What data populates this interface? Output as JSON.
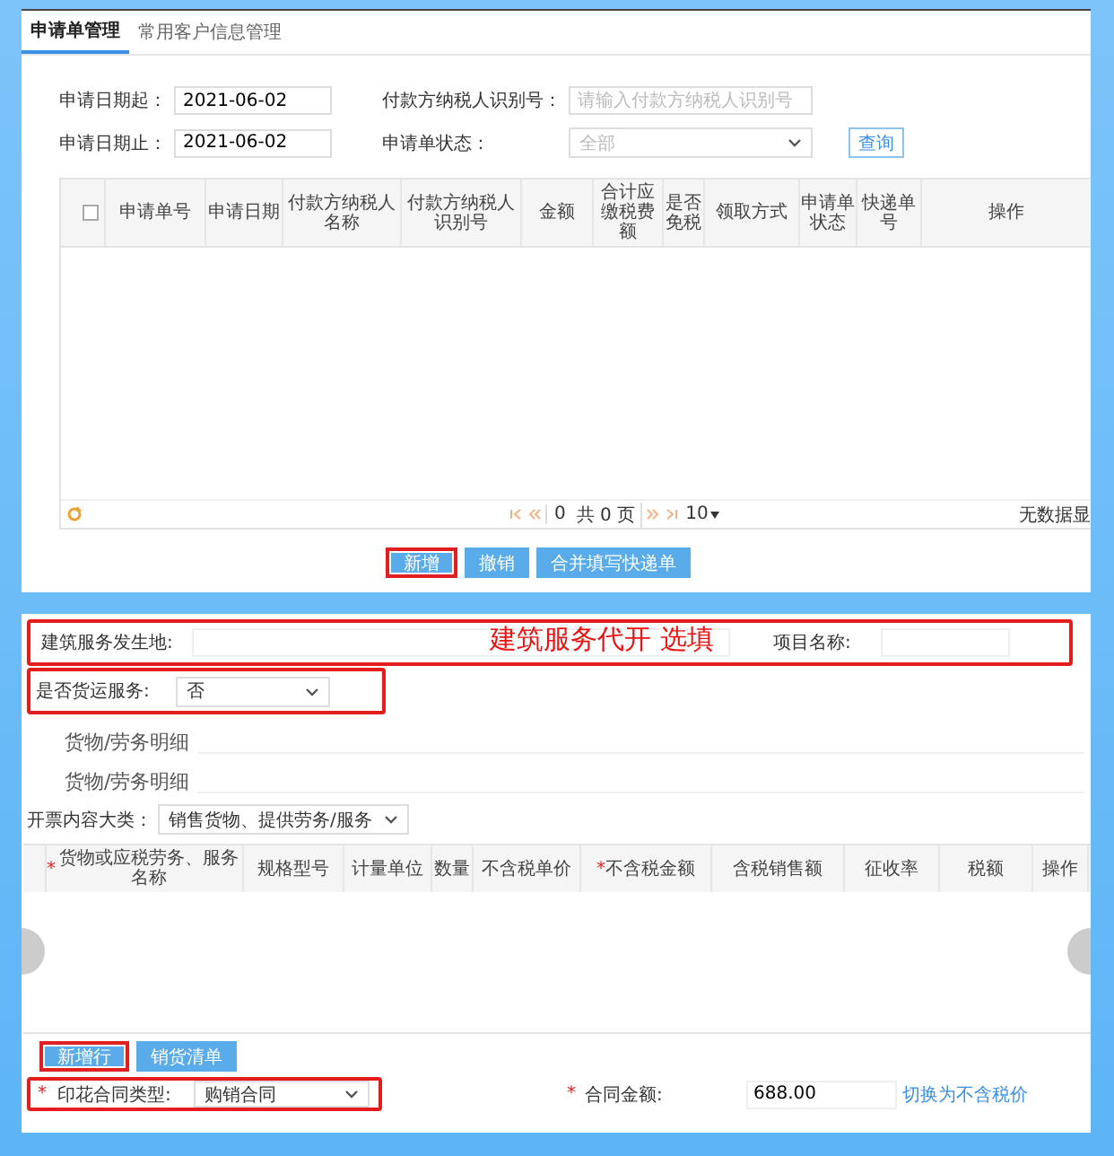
{
  "top_panel": {
    "tabs": [
      {
        "label": "申请单管理",
        "selected": true
      },
      {
        "label": "常用客户信息管理",
        "selected": false
      }
    ],
    "filters": [
      {
        "kind": "text",
        "label": "申请日期起：",
        "value": "2021-06-02"
      },
      {
        "kind": "text",
        "label": "付款方纳税人识别号：",
        "placeholder": "请输入付款方纳税人识别号"
      },
      {
        "kind": "text",
        "label": "申请日期止：",
        "value": "2021-06-02"
      },
      {
        "kind": "select",
        "label": "申请单状态：",
        "placeholder": "全部"
      }
    ],
    "query_button": "查询",
    "table": {
      "select_all_checked": false,
      "columns": [
        "申请单号",
        "申请日期",
        "付款方纳税人名称",
        "付款方纳税人识别号",
        "金额",
        "合计应缴税费额",
        "是否免税",
        "领取方式",
        "申请单状态",
        "快递单号",
        "操作"
      ]
    },
    "pager": {
      "page": "0",
      "total": "共 0 页",
      "page_size": "10",
      "status": "无数据显"
    },
    "actions": [
      {
        "label": "新增",
        "highlighted": true
      },
      {
        "label": "撤销",
        "highlighted": false
      },
      {
        "label": "合并填写快递单",
        "highlighted": false
      }
    ]
  },
  "bottom_panel": {
    "construction_row": {
      "highlighted": true,
      "place_label": "建筑服务发生地:",
      "annotation": "建筑服务代开 选填",
      "project_label": "项目名称:"
    },
    "freight_row": {
      "highlighted": true,
      "label": "是否货运服务:",
      "value": "否"
    },
    "section_titles": [
      "货物/劳务明细",
      "货物/劳务明细"
    ],
    "category": {
      "label": "开票内容大类：",
      "value": "销售货物、提供劳务/服务"
    },
    "table": {
      "columns": [
        {
          "label": "货物或应税劳务、服务名称",
          "mark": "*"
        },
        {
          "label": "规格型号"
        },
        {
          "label": "计量单位"
        },
        {
          "label": "数量"
        },
        {
          "label": "不含税单价"
        },
        {
          "label": "不含税金额",
          "mark": "*"
        },
        {
          "label": "含税销售额"
        },
        {
          "label": "征收率"
        },
        {
          "label": "税额"
        },
        {
          "label": "操作"
        }
      ]
    },
    "actions": [
      {
        "label": "新增行",
        "highlighted": true
      },
      {
        "label": "销货清单",
        "highlighted": false
      }
    ],
    "contract_row": {
      "highlighted": true,
      "mark": "*",
      "type_label": "印花合同类型:",
      "type_value": "购销合同",
      "amount_mark": "*",
      "amount_label": "合同金额:",
      "amount_value": "688.00",
      "switch_link": "切换为不含税价"
    }
  }
}
